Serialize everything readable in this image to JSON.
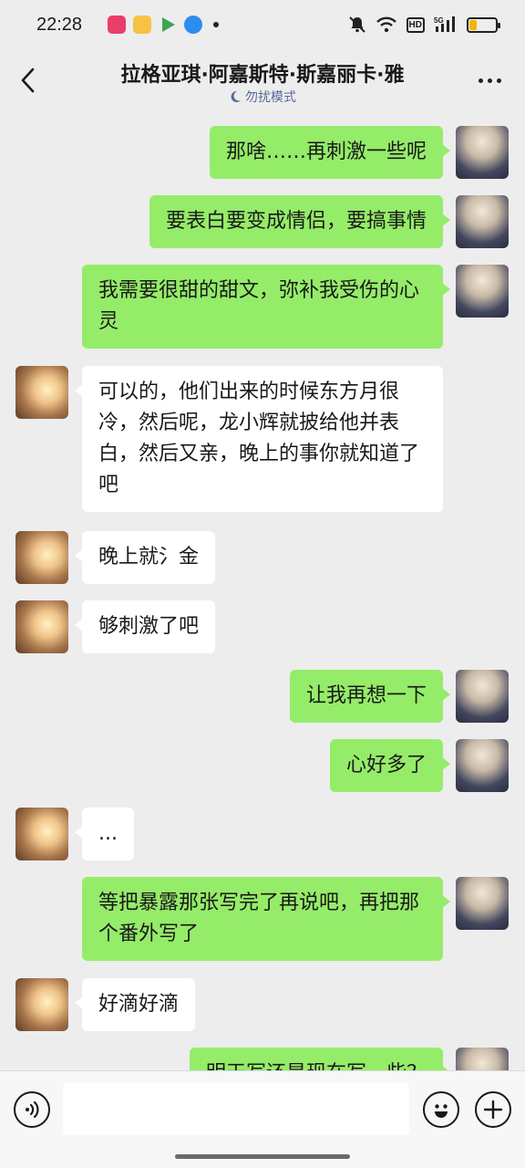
{
  "status_bar": {
    "time": "22:28",
    "hd_label": "HD",
    "network": "5G",
    "battery_level": 0.28
  },
  "header": {
    "title": "拉格亚琪·阿嘉斯特·斯嘉丽卡·雅",
    "subtitle": "勿扰模式"
  },
  "messages": [
    {
      "from": "self",
      "text": "那啥……再刺激一些呢"
    },
    {
      "from": "self",
      "text": "要表白要变成情侣，要搞事情"
    },
    {
      "from": "self",
      "text": "我需要很甜的甜文，弥补我受伤的心灵"
    },
    {
      "from": "other",
      "text": "可以的，他们出来的时候东方月很冷，然后呢，龙小辉就披给他并表白，然后又亲，晚上的事你就知道了吧"
    },
    {
      "from": "other",
      "text": "晚上就氵金"
    },
    {
      "from": "other",
      "text": "够刺激了吧"
    },
    {
      "from": "self",
      "text": "让我再想一下"
    },
    {
      "from": "self",
      "text": "心好多了"
    },
    {
      "from": "other",
      "text": "..."
    },
    {
      "from": "self",
      "text": "等把暴露那张写完了再说吧，再把那个番外写了"
    },
    {
      "from": "other",
      "text": "好滴好滴"
    },
    {
      "from": "self",
      "text": "明天写还是现在写一些？"
    }
  ],
  "colors": {
    "self_bubble": "#95ec69",
    "other_bubble": "#ffffff",
    "background": "#ededed"
  }
}
